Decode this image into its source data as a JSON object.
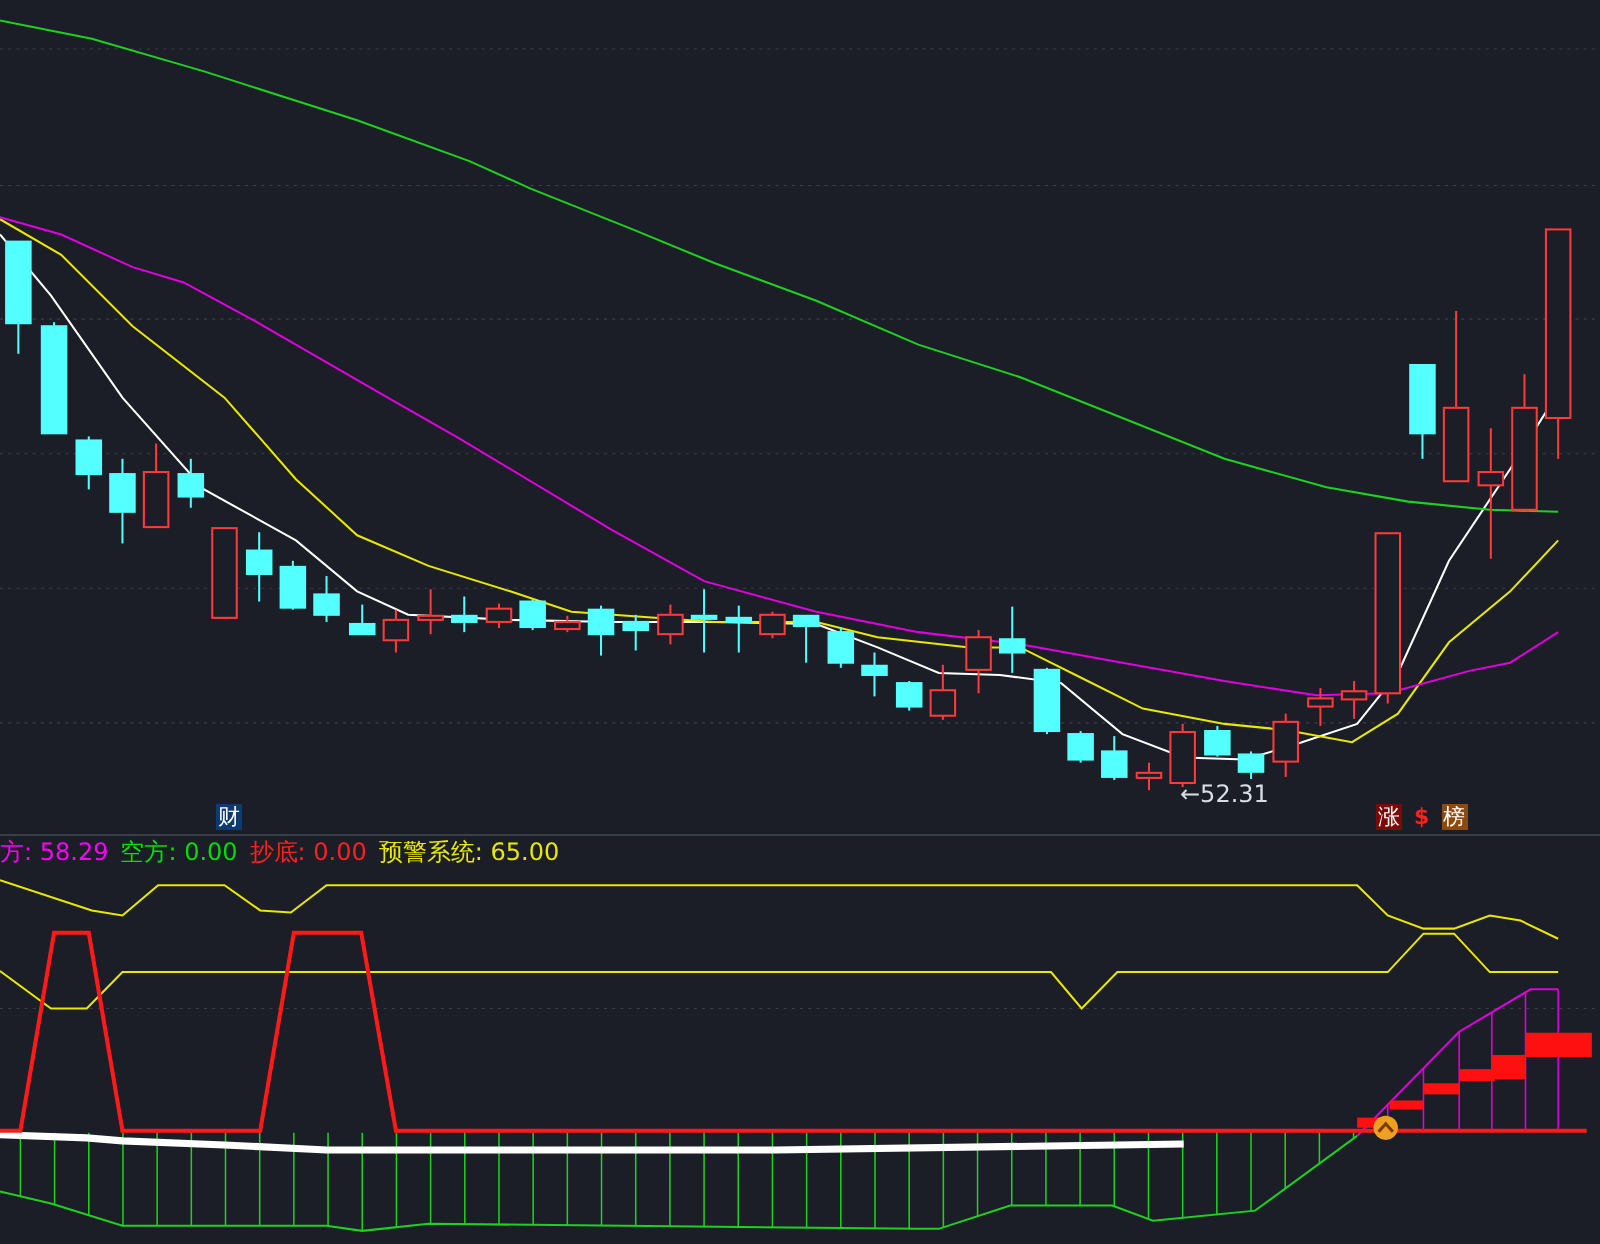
{
  "main_chart": {
    "low_label": "←52.31",
    "badges": [
      {
        "text": "财",
        "kind": "tag",
        "color": "#0e3a6e"
      },
      {
        "text": "涨",
        "kind": "tag",
        "color": "#7a0a0a"
      },
      {
        "text": "$",
        "kind": "glyph",
        "color": "#ff2020"
      },
      {
        "text": "榜",
        "kind": "tag",
        "color": "#8a4a10"
      }
    ]
  },
  "indicator": {
    "legend": [
      {
        "text": "方: 58.29",
        "color": "#ff00ff"
      },
      {
        "text": "空方: 0.00",
        "color": "#00e000"
      },
      {
        "text": "抄底: 0.00",
        "color": "#ff2020"
      },
      {
        "text": "预警系统: 65.00",
        "color": "#e8e800"
      }
    ]
  }
}
